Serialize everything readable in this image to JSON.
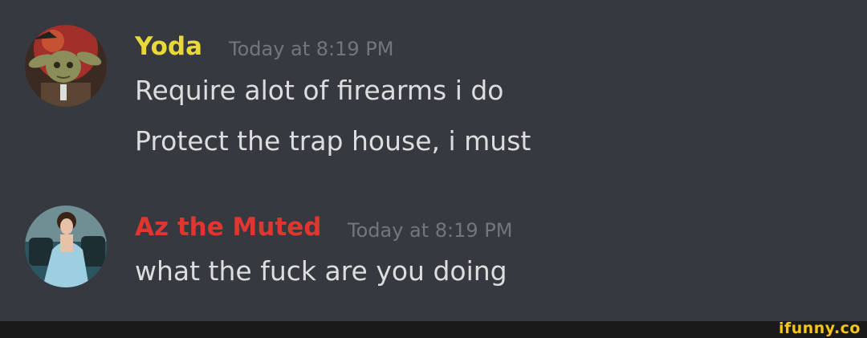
{
  "messages": [
    {
      "author": "Yoda",
      "author_color": "#e8d83a",
      "timestamp": "Today at 8:19 PM",
      "avatar": "yoda-avatar",
      "lines": [
        "Require alot of firearms i do",
        "Protect the trap house, i must"
      ]
    },
    {
      "author": "Az the Muted",
      "author_color": "#e0362f",
      "timestamp": "Today at 8:19 PM",
      "avatar": "az-avatar",
      "lines": [
        "what the fuck are you doing"
      ]
    }
  ],
  "watermark": {
    "text": "ifunny.co",
    "color": "#f5c518"
  }
}
